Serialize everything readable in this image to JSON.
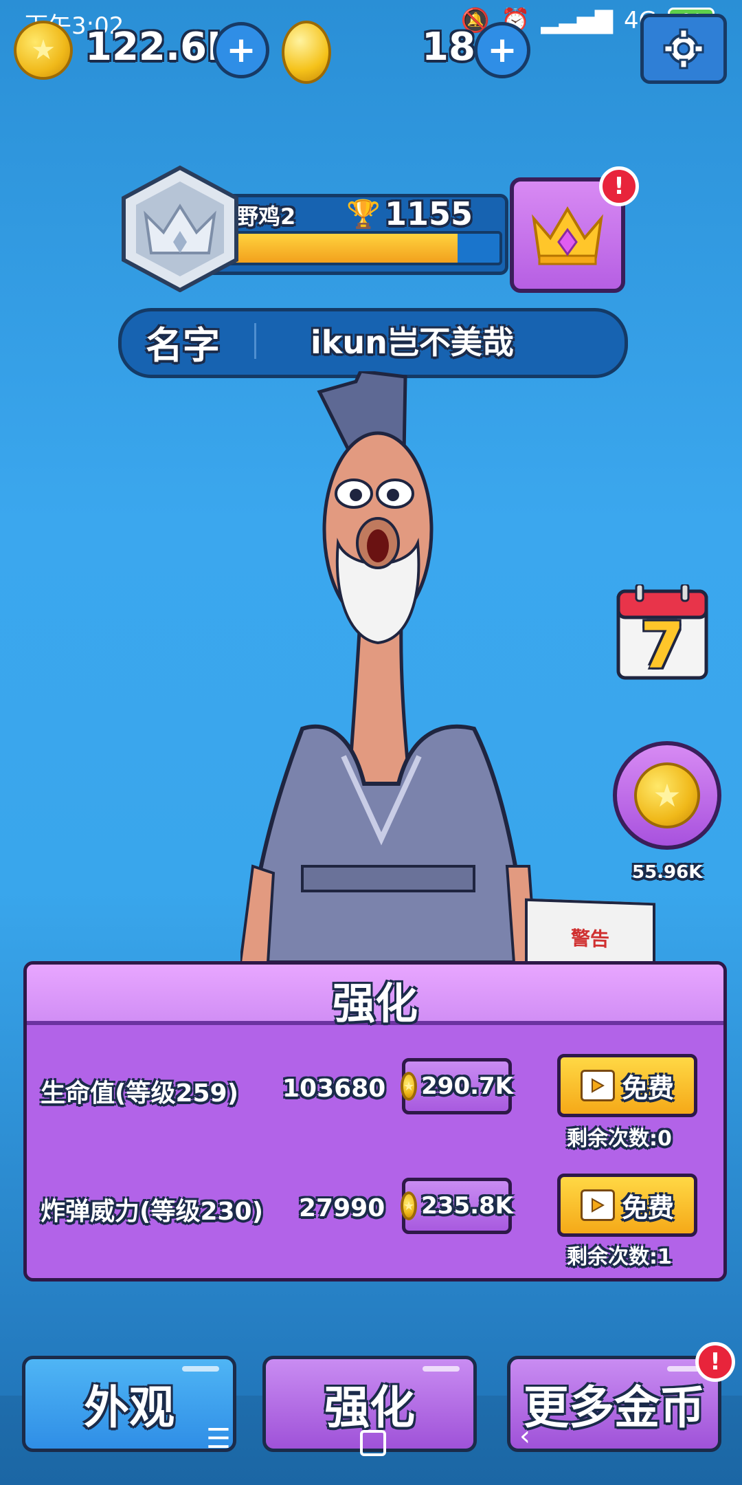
{
  "status_bar": {
    "time": "下午3:02",
    "network": "4G",
    "battery": "94"
  },
  "currency": {
    "coins": "122.6K",
    "gems": "18"
  },
  "rank": {
    "tier": "野鸡2",
    "trophies": "1155",
    "progress": 0.85
  },
  "profile": {
    "name_label": "名字",
    "name_value": "ikun岂不美哉"
  },
  "calendar": {
    "day": "7"
  },
  "coin_reward": {
    "amount": "55.96K"
  },
  "upgrade": {
    "title": "强化",
    "rows": [
      {
        "label": "生命值(等级259)",
        "value": "103680",
        "cost": "290.7K",
        "free_label": "免费",
        "remaining": "剩余次数:0"
      },
      {
        "label": "炸弹威力(等级230)",
        "value": "27990",
        "cost": "235.8K",
        "free_label": "免费",
        "remaining": "剩余次数:1"
      }
    ]
  },
  "scene": {
    "box_label": "警告"
  },
  "nav": {
    "appearance": "外观",
    "upgrade": "强化",
    "more_coins": "更多金币"
  },
  "colors": {
    "accent_blue": "#2f8ee6",
    "panel_purple": "#b263e8",
    "gold": "#f5a918",
    "alert_red": "#e8243b"
  }
}
